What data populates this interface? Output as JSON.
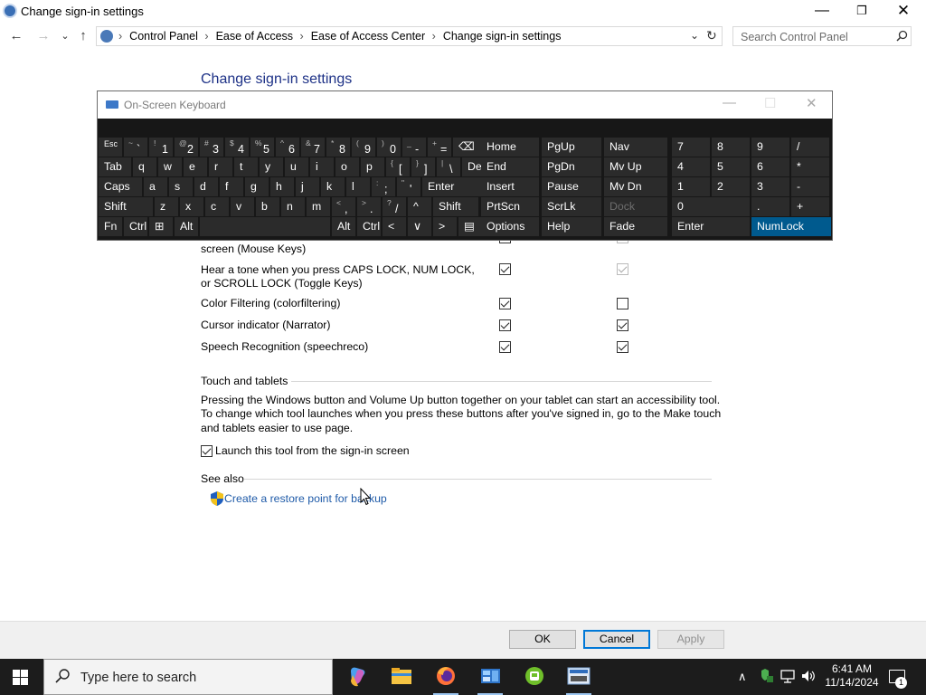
{
  "window": {
    "title": "Change sign-in settings",
    "minimize_glyph": "—",
    "maximize_glyph": "❐",
    "close_glyph": "✕"
  },
  "nav": {
    "back_glyph": "←",
    "forward_glyph": "→",
    "recent_glyph": "⌄",
    "up_glyph": "↑",
    "breadcrumbs": [
      "Control Panel",
      "Ease of Access",
      "Ease of Access Center",
      "Change sign-in settings"
    ],
    "separator": "›",
    "dropdown_glyph": "⌄",
    "refresh_glyph": "↻",
    "search_placeholder": "Search Control Panel"
  },
  "content": {
    "page_title": "Change sign-in settings",
    "options": [
      {
        "label": "screen (Mouse Keys)",
        "col1_checked": false,
        "col2_checked": false
      },
      {
        "label": "Hear a tone when you press CAPS LOCK, NUM LOCK, or SCROLL LOCK (Toggle Keys)",
        "col1_checked": true,
        "col2_checked": true,
        "col2_disabled": true
      },
      {
        "label": "Color Filtering (colorfiltering)",
        "col1_checked": true,
        "col2_checked": false
      },
      {
        "label": "Cursor indicator (Narrator)",
        "col1_checked": true,
        "col2_checked": true
      },
      {
        "label": "Speech Recognition (speechreco)",
        "col1_checked": true,
        "col2_checked": true
      }
    ],
    "touch_heading": "Touch and tablets",
    "touch_paragraph": "Pressing the Windows button and Volume Up button together on your tablet can start an accessibility tool. To change which tool launches when you press these buttons after you've signed in, go to the Make touch and tablets easier to use page.",
    "launch_label": "Launch this tool from the sign-in screen",
    "launch_checked": true,
    "see_also_heading": "See also",
    "restore_link": "Create a restore point for backup"
  },
  "buttons": {
    "ok": "OK",
    "cancel": "Cancel",
    "apply": "Apply"
  },
  "osk": {
    "title": "On-Screen Keyboard",
    "minimize_glyph": "—",
    "maximize_glyph": "☐",
    "close_glyph": "✕",
    "row1": [
      "Esc",
      "~ `",
      "! 1",
      "@ 2",
      "# 3",
      "$ 4",
      "% 5",
      "^ 6",
      "& 7",
      "* 8",
      "( 9",
      ") 0",
      "_ -",
      "+ =",
      "⌫"
    ],
    "row2": [
      "Tab",
      "q",
      "w",
      "e",
      "r",
      "t",
      "y",
      "u",
      "i",
      "o",
      "p",
      "{ [",
      "} ]",
      "| \\",
      "Del"
    ],
    "row3": [
      "Caps",
      "a",
      "s",
      "d",
      "f",
      "g",
      "h",
      "j",
      "k",
      "l",
      ": ;",
      "\" '",
      "Enter"
    ],
    "row4": [
      "Shift",
      "z",
      "x",
      "c",
      "v",
      "b",
      "n",
      "m",
      "< ,",
      "> .",
      "? /",
      "^",
      "Shift"
    ],
    "row5": [
      "Fn",
      "Ctrl",
      "⊞",
      "Alt",
      "",
      "Alt",
      "Ctrl",
      "<",
      "∨",
      ">",
      "▤"
    ],
    "nav_keys": [
      "Home",
      "PgUp",
      "Nav",
      "End",
      "PgDn",
      "Mv Up",
      "Insert",
      "Pause",
      "Mv Dn",
      "PrtScn",
      "ScrLk",
      "Dock",
      "Options",
      "Help",
      "Fade"
    ],
    "numpad_keys": [
      "7",
      "8",
      "9",
      "/",
      "4",
      "5",
      "6",
      "*",
      "1",
      "2",
      "3",
      "-",
      "0",
      ".",
      "+",
      "Enter",
      "NumLock"
    ]
  },
  "taskbar": {
    "search_placeholder": "Type here to search",
    "time": "6:41 AM",
    "date": "11/14/2024",
    "notification_count": "1",
    "tray_chevron": "∧",
    "apps": [
      "copilot-icon",
      "file-explorer-icon",
      "firefox-icon",
      "control-panel-icon",
      "green-app-icon",
      "on-screen-keyboard-icon"
    ]
  },
  "colors": {
    "title_blue": "#1e3287",
    "link_blue": "#1e5aa8",
    "osk_bg": "#171717",
    "osk_key": "#2b2b2b",
    "osk_highlight": "#005a8e",
    "taskbar": "#1c1c1c"
  }
}
